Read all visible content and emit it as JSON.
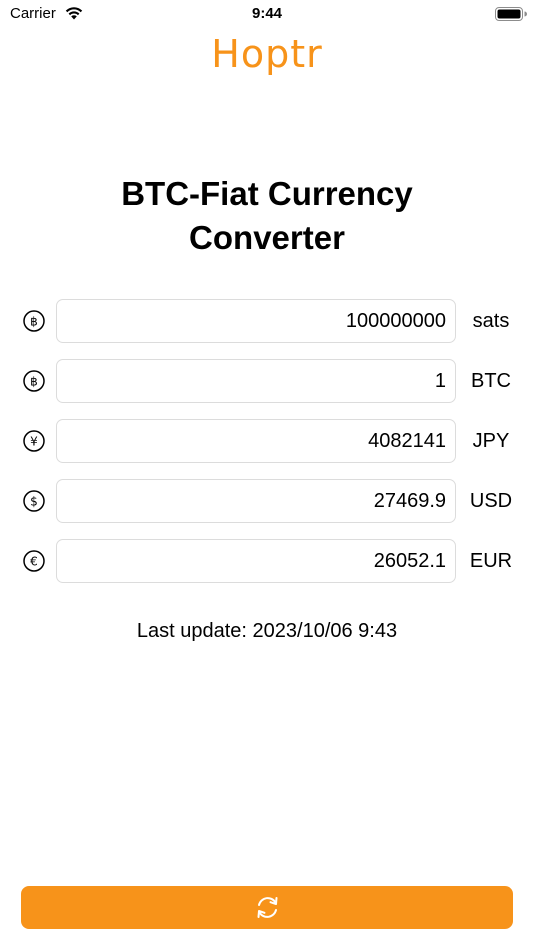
{
  "status_bar": {
    "carrier": "Carrier",
    "time": "9:44"
  },
  "app": {
    "title": "Hoptr",
    "accent_color": "#f7931a"
  },
  "heading": {
    "line1": "BTC-Fiat Currency",
    "line2": "Converter"
  },
  "rows": [
    {
      "icon": "bitcoin-icon",
      "value": "100000000",
      "unit": "sats"
    },
    {
      "icon": "bitcoin-icon",
      "value": "1",
      "unit": "BTC"
    },
    {
      "icon": "yen-icon",
      "value": "4082141",
      "unit": "JPY"
    },
    {
      "icon": "dollar-icon",
      "value": "27469.9",
      "unit": "USD"
    },
    {
      "icon": "euro-icon",
      "value": "26052.1",
      "unit": "EUR"
    }
  ],
  "last_update": "Last update: 2023/10/06 9:43",
  "refresh_button": {
    "icon": "refresh-icon"
  }
}
